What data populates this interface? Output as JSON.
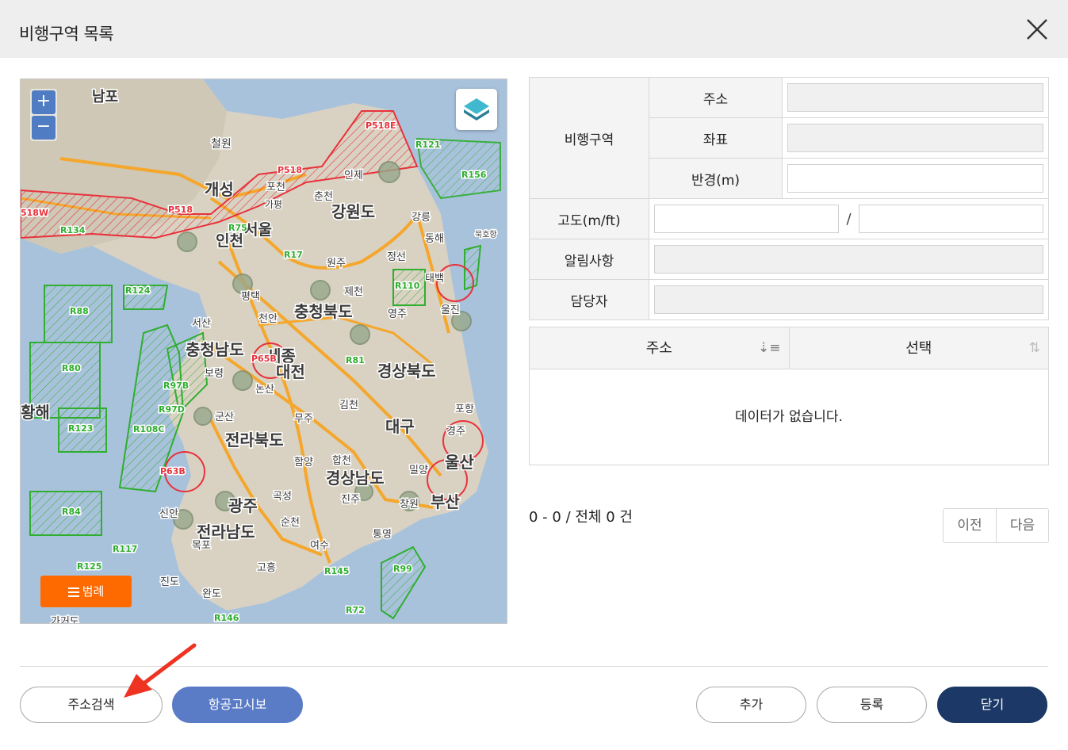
{
  "dialog": {
    "title": "비행구역 목록"
  },
  "map": {
    "zoom_in": "+",
    "zoom_out": "−",
    "legend_button": "범례",
    "place_labels": [
      {
        "text": "남포"
      },
      {
        "text": "철원"
      },
      {
        "text": "개성"
      },
      {
        "text": "포천"
      },
      {
        "text": "춘천"
      },
      {
        "text": "인제"
      },
      {
        "text": "가평"
      },
      {
        "text": "강원도"
      },
      {
        "text": "강릉"
      },
      {
        "text": "동해"
      },
      {
        "text": "인천"
      },
      {
        "text": "서울"
      },
      {
        "text": "원주"
      },
      {
        "text": "정선"
      },
      {
        "text": "제천"
      },
      {
        "text": "태백"
      },
      {
        "text": "영주"
      },
      {
        "text": "울진"
      },
      {
        "text": "평택"
      },
      {
        "text": "천안"
      },
      {
        "text": "충청북도"
      },
      {
        "text": "서산"
      },
      {
        "text": "충청남도"
      },
      {
        "text": "세종"
      },
      {
        "text": "대전"
      },
      {
        "text": "보령"
      },
      {
        "text": "논산"
      },
      {
        "text": "경상북도"
      },
      {
        "text": "김천"
      },
      {
        "text": "포항"
      },
      {
        "text": "군산"
      },
      {
        "text": "무주"
      },
      {
        "text": "대구"
      },
      {
        "text": "경주"
      },
      {
        "text": "전라북도"
      },
      {
        "text": "함양"
      },
      {
        "text": "합천"
      },
      {
        "text": "밀양"
      },
      {
        "text": "울산"
      },
      {
        "text": "경상남도"
      },
      {
        "text": "광주"
      },
      {
        "text": "곡성"
      },
      {
        "text": "진주"
      },
      {
        "text": "창원"
      },
      {
        "text": "부산"
      },
      {
        "text": "신안"
      },
      {
        "text": "전라남도"
      },
      {
        "text": "순천"
      },
      {
        "text": "통영"
      },
      {
        "text": "목포"
      },
      {
        "text": "여수"
      },
      {
        "text": "고흥"
      },
      {
        "text": "진도"
      },
      {
        "text": "완도"
      },
      {
        "text": "황해"
      },
      {
        "text": "묵호항"
      },
      {
        "text": "가거도"
      }
    ],
    "zone_labels": [
      {
        "text": "P518E",
        "color": "#e8323c"
      },
      {
        "text": "R121",
        "color": "#2fae2f"
      },
      {
        "text": "P518",
        "color": "#e8323c"
      },
      {
        "text": "R156",
        "color": "#2fae2f"
      },
      {
        "text": "P518",
        "color": "#e8323c"
      },
      {
        "text": "R75",
        "color": "#2fae2f"
      },
      {
        "text": "518W",
        "color": "#e8323c"
      },
      {
        "text": "R134",
        "color": "#2fae2f"
      },
      {
        "text": "R17",
        "color": "#2fae2f"
      },
      {
        "text": "R124",
        "color": "#2fae2f"
      },
      {
        "text": "R110",
        "color": "#2fae2f"
      },
      {
        "text": "R88",
        "color": "#2fae2f"
      },
      {
        "text": "P65B",
        "color": "#e8323c"
      },
      {
        "text": "R81",
        "color": "#2fae2f"
      },
      {
        "text": "R80",
        "color": "#2fae2f"
      },
      {
        "text": "R97B",
        "color": "#2fae2f"
      },
      {
        "text": "R97D",
        "color": "#2fae2f"
      },
      {
        "text": "R123",
        "color": "#2fae2f"
      },
      {
        "text": "R108C",
        "color": "#2fae2f"
      },
      {
        "text": "P63B",
        "color": "#e8323c"
      },
      {
        "text": "R84",
        "color": "#2fae2f"
      },
      {
        "text": "R117",
        "color": "#2fae2f"
      },
      {
        "text": "R125",
        "color": "#2fae2f"
      },
      {
        "text": "R145",
        "color": "#2fae2f"
      },
      {
        "text": "R99",
        "color": "#2fae2f"
      },
      {
        "text": "R146",
        "color": "#2fae2f"
      },
      {
        "text": "R72",
        "color": "#2fae2f"
      }
    ]
  },
  "form": {
    "zone_label": "비행구역",
    "address_label": "주소",
    "coord_label": "좌표",
    "radius_label": "반경(m)",
    "altitude_label": "고도(m/ft)",
    "altitude_separator": "/",
    "notice_label": "알림사항",
    "manager_label": "담당자"
  },
  "list": {
    "columns": [
      "주소",
      "선택"
    ],
    "empty_text": "데이터가 없습니다."
  },
  "paging": {
    "summary": "0 - 0 / 전체 0 건",
    "prev": "이전",
    "next": "다음"
  },
  "buttons": {
    "address_search": "주소검색",
    "notam": "항공고시보",
    "add": "추가",
    "register": "등록",
    "close": "닫기"
  },
  "colors": {
    "primary_blue": "#5a7bc6",
    "navy": "#1b3866",
    "legend_orange": "#ff6a00",
    "arrow_red": "#ee3322"
  }
}
